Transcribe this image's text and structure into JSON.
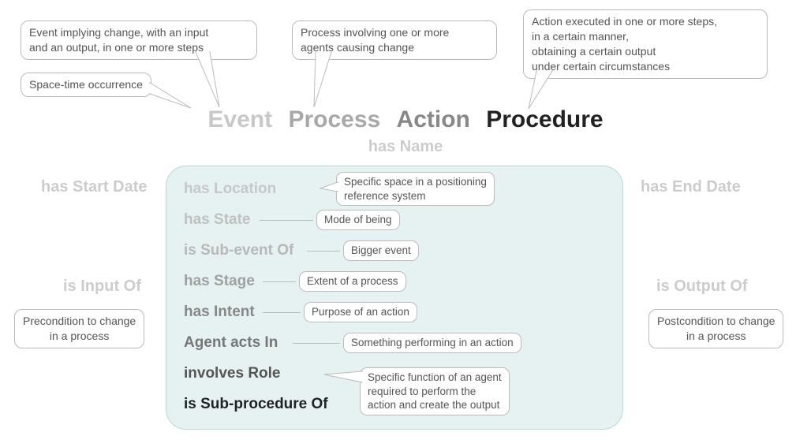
{
  "title": {
    "event": "Event",
    "process": "Process",
    "action": "Action",
    "procedure": "Procedure"
  },
  "title_bubbles": {
    "event_def": "Event implying change, with an input\nand an output, in one or more steps",
    "process_def": "Process involving one or more\nagents causing change",
    "procedure_def": "Action executed in one or more steps,\nin a certain manner,\nobtaining a certain output\nunder certain circumstances",
    "spacetime": "Space-time occurrence"
  },
  "has_name": "has Name",
  "side": {
    "start_date": "has Start Date",
    "end_date": "has End Date",
    "input_of": "is Input Of",
    "output_of": "is Output Of",
    "input_def": "Precondition to change\nin a process",
    "output_def": "Postcondition to change\nin a process"
  },
  "props": {
    "location": "has Location",
    "state": "has State",
    "subevent": "is Sub-event Of",
    "stage": "has Stage",
    "intent": "has Intent",
    "agent": "Agent acts In",
    "role": "involves Role",
    "subproc": "is Sub-procedure Of"
  },
  "defs": {
    "location": "Specific space in a positioning\nreference system",
    "state": "Mode of being",
    "subevent": "Bigger event",
    "stage": "Extent of a process",
    "intent": "Purpose of an action",
    "agent": "Something performing in an action",
    "role": "Specific function of an agent\nrequired to perform the\naction and create the output"
  }
}
